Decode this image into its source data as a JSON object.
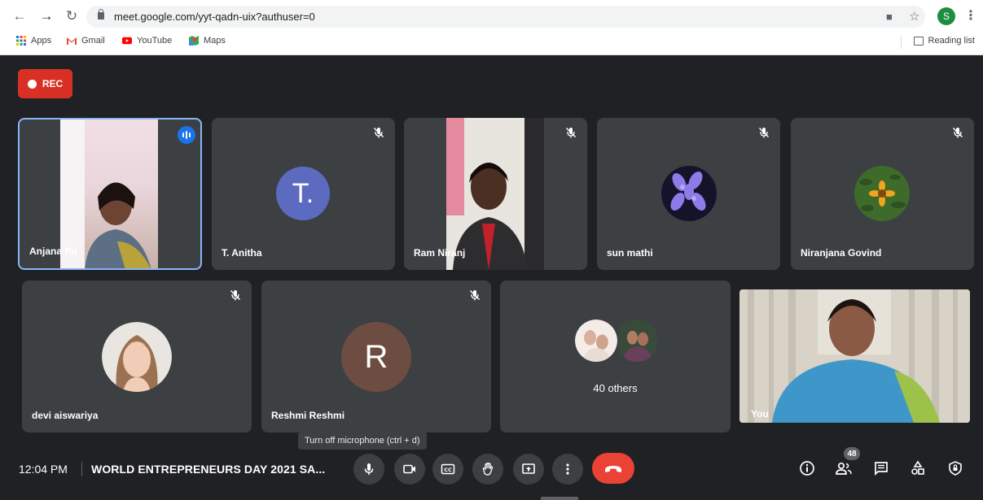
{
  "browser": {
    "url": "meet.google.com/yyt-qadn-uix?authuser=0",
    "profile_initial": "S",
    "bookmarks": [
      {
        "label": "Apps"
      },
      {
        "label": "Gmail"
      },
      {
        "label": "YouTube"
      },
      {
        "label": "Maps"
      }
    ],
    "reading_list": "Reading list"
  },
  "rec_label": "REC",
  "participants": [
    {
      "name": "Anjana Pu",
      "type": "video",
      "speaking": true
    },
    {
      "name": "T. Anitha",
      "type": "initial",
      "initial": "T.",
      "avatar_color": "#5c6bc0",
      "muted": true
    },
    {
      "name": "Ram Niranj",
      "type": "video",
      "muted": true
    },
    {
      "name": "sun mathi",
      "type": "photo",
      "muted": true
    },
    {
      "name": "Niranjana Govind",
      "type": "photo",
      "muted": true
    },
    {
      "name": "devi aiswariya",
      "type": "photo",
      "muted": true
    },
    {
      "name": "Reshmi Reshmi",
      "type": "initial",
      "initial": "R",
      "avatar_color": "#6d4c41",
      "muted": true
    },
    {
      "name": "40 others",
      "type": "group"
    },
    {
      "name": "You",
      "type": "video"
    }
  ],
  "tooltip": "Turn off microphone (ctrl + d)",
  "footer": {
    "time": "12:04 PM",
    "meeting_title": "WORLD ENTREPRENEURS DAY 2021 SA...",
    "participant_count": "48"
  },
  "colors": {
    "background": "#202124",
    "tile": "#3c4043",
    "end_call": "#ea4335",
    "rec": "#d93025",
    "active_border": "#8ab4f8"
  }
}
